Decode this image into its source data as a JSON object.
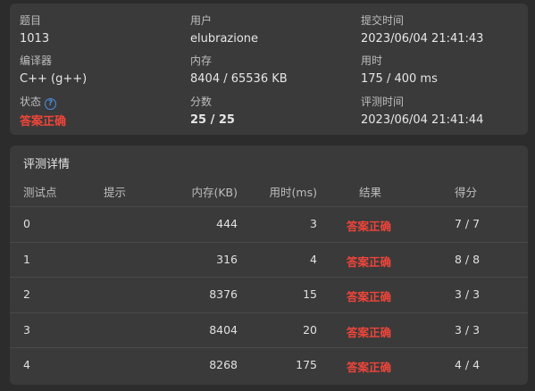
{
  "summary": {
    "problem": {
      "label": "题目",
      "value": "1013"
    },
    "user": {
      "label": "用户",
      "value": "elubrazione"
    },
    "submit_time": {
      "label": "提交时间",
      "value": "2023/06/04 21:41:43"
    },
    "compiler": {
      "label": "编译器",
      "value": "C++ (g++)"
    },
    "memory": {
      "label": "内存",
      "value": "8404 / 65536 KB"
    },
    "time": {
      "label": "用时",
      "value": "175 / 400 ms"
    },
    "status": {
      "label": "状态",
      "value": "答案正确",
      "help_icon": "question-circle-icon"
    },
    "score": {
      "label": "分数",
      "value": "25 / 25"
    },
    "judge_time": {
      "label": "评测时间",
      "value": "2023/06/04 21:41:44"
    }
  },
  "details": {
    "title": "评测详情",
    "columns": {
      "case": "测试点",
      "hint": "提示",
      "memory": "内存(KB)",
      "time": "用时(ms)",
      "result": "结果",
      "score": "得分"
    },
    "rows": [
      {
        "case": "0",
        "hint": "",
        "memory": "444",
        "time": "3",
        "result": "答案正确",
        "score": "7 / 7"
      },
      {
        "case": "1",
        "hint": "",
        "memory": "316",
        "time": "4",
        "result": "答案正确",
        "score": "8 / 8"
      },
      {
        "case": "2",
        "hint": "",
        "memory": "8376",
        "time": "15",
        "result": "答案正确",
        "score": "3 / 3"
      },
      {
        "case": "3",
        "hint": "",
        "memory": "8404",
        "time": "20",
        "result": "答案正确",
        "score": "3 / 3"
      },
      {
        "case": "4",
        "hint": "",
        "memory": "8268",
        "time": "175",
        "result": "答案正确",
        "score": "4 / 4"
      }
    ]
  },
  "colors": {
    "background": "#2c2c2c",
    "card": "#3a3a3a",
    "accepted": "#f0453a",
    "help_icon": "#4a90e2"
  }
}
